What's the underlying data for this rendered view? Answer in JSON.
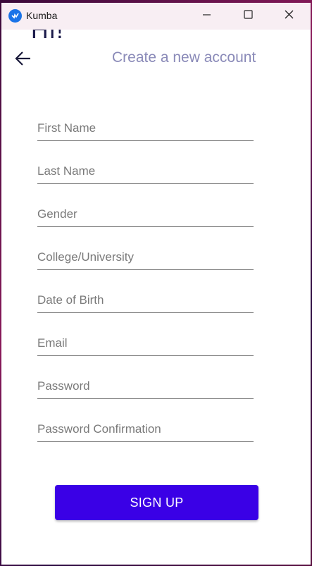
{
  "window": {
    "title": "Kumba",
    "icon": "kumba-app-icon",
    "controls": {
      "minimize_icon": "minimize-icon",
      "maximize_icon": "maximize-icon",
      "close_icon": "close-icon"
    }
  },
  "header": {
    "greeting": "Hi!",
    "title": "Create a new account",
    "back_icon": "arrow-left-icon"
  },
  "form": {
    "fields": [
      {
        "placeholder": "First Name",
        "value": ""
      },
      {
        "placeholder": "Last Name",
        "value": ""
      },
      {
        "placeholder": "Gender",
        "value": ""
      },
      {
        "placeholder": "College/University",
        "value": ""
      },
      {
        "placeholder": "Date of Birth",
        "value": ""
      },
      {
        "placeholder": "Email",
        "value": ""
      },
      {
        "placeholder": "Password",
        "value": ""
      },
      {
        "placeholder": "Password Confirmation",
        "value": ""
      }
    ],
    "submit_label": "SIGN UP"
  },
  "colors": {
    "accent": "#3a00e6",
    "title": "#8a8ab8",
    "titlebar": "#f8eef3"
  }
}
